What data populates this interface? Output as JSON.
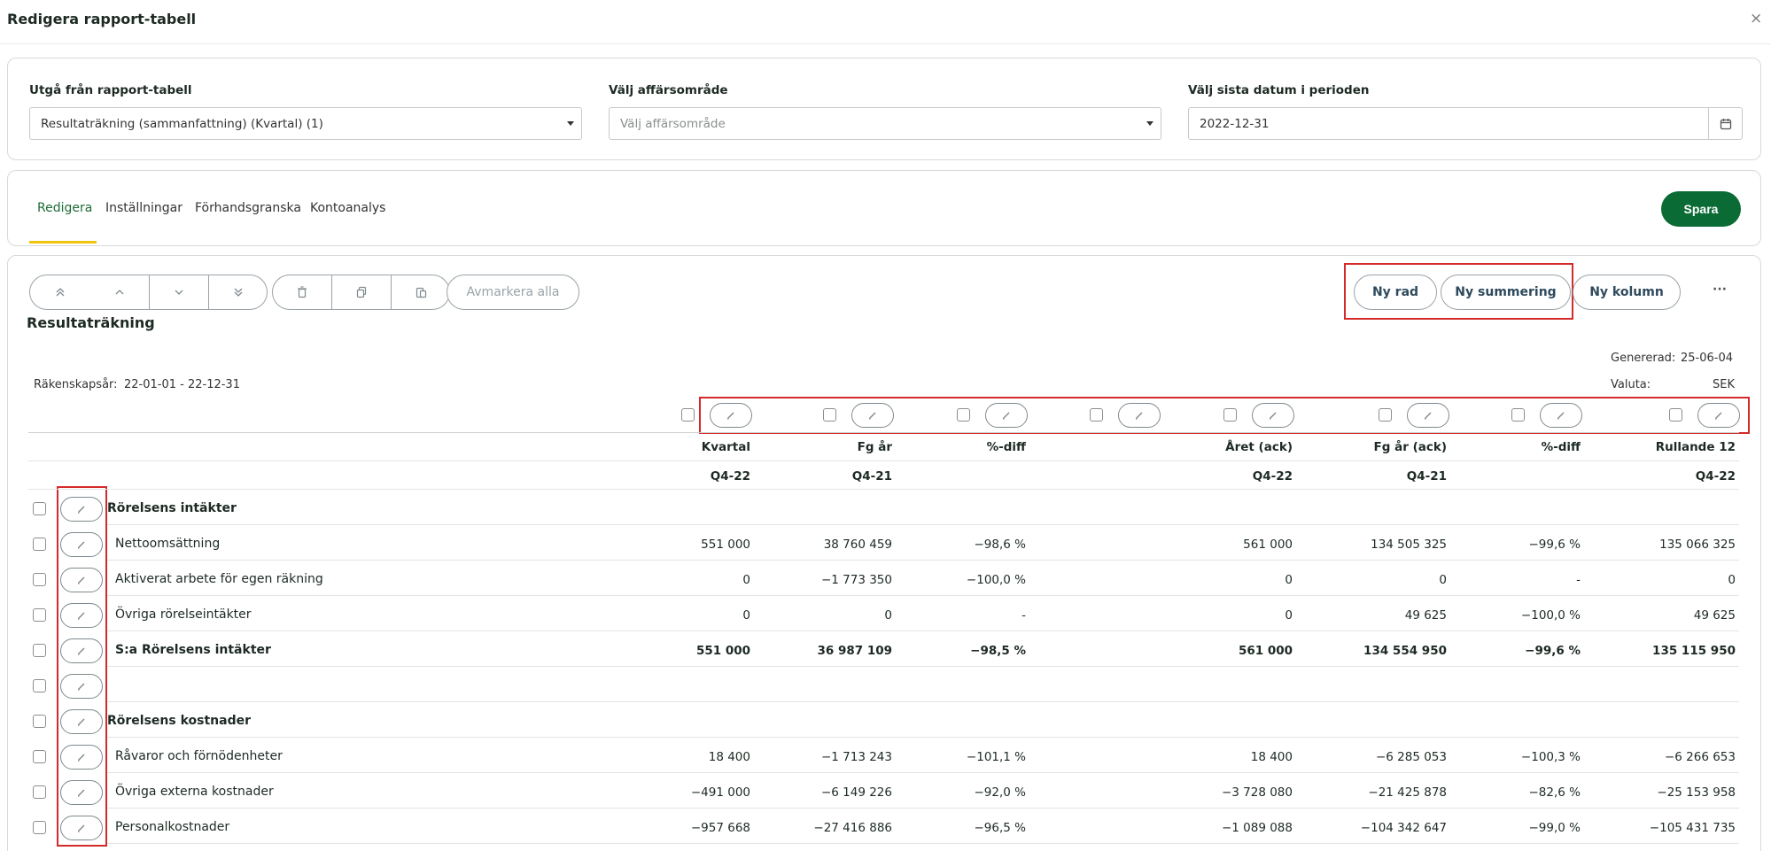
{
  "dialog": {
    "title": "Redigera rapport-tabell",
    "close": "×"
  },
  "filters": {
    "source": {
      "label": "Utgå från rapport-tabell",
      "value": "Resultaträkning (sammanfattning) (Kvartal) (1)"
    },
    "area": {
      "label": "Välj affärsområde",
      "placeholder": "Välj affärsområde"
    },
    "date": {
      "label": "Välj sista datum i perioden",
      "value": "2022-12-31"
    }
  },
  "tabs": [
    {
      "label": "Redigera",
      "active": true
    },
    {
      "label": "Inställningar"
    },
    {
      "label": "Förhandsgranska"
    },
    {
      "label": "Kontoanalys"
    }
  ],
  "save_label": "Spara",
  "toolbar": {
    "deselect_all": "Avmarkera alla",
    "new_row": "Ny rad",
    "new_sum": "Ny summering",
    "new_column": "Ny kolumn",
    "more": "···"
  },
  "report": {
    "title": "Resultaträkning",
    "fiscal_label": "Räkenskapsår:",
    "fiscal_value": "22-01-01 - 22-12-31",
    "generated_label": "Genererad:",
    "generated_value": "25-06-04",
    "currency_label": "Valuta:",
    "currency_value": "SEK"
  },
  "columns": [
    {
      "label": "Kvartal",
      "period": "Q4-22"
    },
    {
      "label": "Fg år",
      "period": "Q4-21"
    },
    {
      "label": "%-diff",
      "period": ""
    },
    {
      "label": "Året (ack)",
      "period": "Q4-22"
    },
    {
      "label": "Fg år (ack)",
      "period": "Q4-21"
    },
    {
      "label": "%-diff",
      "period": ""
    },
    {
      "label": "Rullande 12",
      "period": "Q4-22"
    }
  ],
  "rows": [
    {
      "label": "Rörelsens intäkter",
      "type": "header",
      "values": [
        "",
        "",
        "",
        "",
        "",
        "",
        ""
      ]
    },
    {
      "label": "Nettoomsättning",
      "type": "row",
      "values": [
        "551 000",
        "38 760 459",
        "−98,6 %",
        "561 000",
        "134 505 325",
        "−99,6 %",
        "135 066 325"
      ]
    },
    {
      "label": "Aktiverat arbete för egen räkning",
      "type": "row",
      "values": [
        "0",
        "−1 773 350",
        "−100,0 %",
        "0",
        "0",
        "-",
        "0"
      ]
    },
    {
      "label": "Övriga rörelseintäkter",
      "type": "row",
      "values": [
        "0",
        "0",
        "-",
        "0",
        "49 625",
        "−100,0 %",
        "49 625"
      ]
    },
    {
      "label": "S:a Rörelsens intäkter",
      "type": "sum",
      "values": [
        "551 000",
        "36 987 109",
        "−98,5 %",
        "561 000",
        "134 554 950",
        "−99,6 %",
        "135 115 950"
      ]
    },
    {
      "label": "",
      "type": "empty",
      "values": [
        "",
        "",
        "",
        "",
        "",
        "",
        ""
      ]
    },
    {
      "label": "Rörelsens kostnader",
      "type": "header",
      "values": [
        "",
        "",
        "",
        "",
        "",
        "",
        ""
      ]
    },
    {
      "label": "Råvaror och förnödenheter",
      "type": "row",
      "values": [
        "18 400",
        "−1 713 243",
        "−101,1 %",
        "18 400",
        "−6 285 053",
        "−100,3 %",
        "−6 266 653"
      ]
    },
    {
      "label": "Övriga externa kostnader",
      "type": "row",
      "values": [
        "−491 000",
        "−6 149 226",
        "−92,0 %",
        "−3 728 080",
        "−21 425 878",
        "−82,6 %",
        "−25 153 958"
      ]
    },
    {
      "label": "Personalkostnader",
      "type": "row",
      "values": [
        "−957 668",
        "−27 416 886",
        "−96,5 %",
        "−1 089 088",
        "−104 342 647",
        "−99,0 %",
        "−105 431 735"
      ]
    }
  ]
}
